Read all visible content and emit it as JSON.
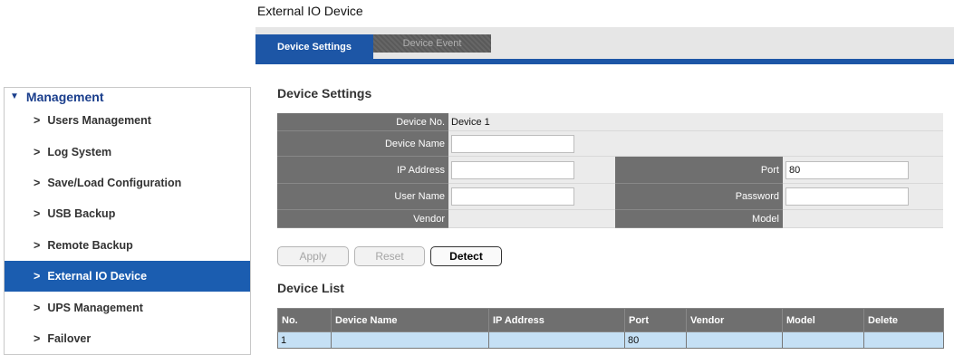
{
  "sidebar": {
    "section_label": "Management",
    "items": [
      {
        "label": "Users Management"
      },
      {
        "label": "Log System"
      },
      {
        "label": "Save/Load Configuration"
      },
      {
        "label": "USB Backup"
      },
      {
        "label": "Remote Backup"
      },
      {
        "label": "External IO Device",
        "active": true
      },
      {
        "label": "UPS Management"
      },
      {
        "label": "Failover"
      }
    ]
  },
  "page": {
    "title": "External IO Device",
    "tabs": [
      {
        "label": "Device Settings",
        "active": true
      },
      {
        "label": "Device Event",
        "active": false
      }
    ]
  },
  "device_settings": {
    "title": "Device Settings",
    "device_no_label": "Device No.",
    "device_no_value": "Device 1",
    "device_name_label": "Device Name",
    "device_name_value": "",
    "ip_address_label": "IP Address",
    "ip_address_value": "",
    "port_label": "Port",
    "port_value": "80",
    "user_name_label": "User Name",
    "user_name_value": "",
    "password_label": "Password",
    "password_value": "",
    "vendor_label": "Vendor",
    "vendor_value": "",
    "model_label": "Model",
    "model_value": ""
  },
  "buttons": {
    "apply": "Apply",
    "reset": "Reset",
    "detect": "Detect"
  },
  "device_list": {
    "title": "Device List",
    "columns": [
      "No.",
      "Device Name",
      "IP Address",
      "Port",
      "Vendor",
      "Model",
      "Delete"
    ],
    "rows": [
      [
        "1",
        "",
        "",
        "80",
        "",
        "",
        ""
      ]
    ]
  },
  "colors": {
    "accent": "#1d56a6",
    "sidebar_active": "#1b5db0",
    "header_gray": "#6f6f6f",
    "row_blue": "#c5e0f5"
  }
}
